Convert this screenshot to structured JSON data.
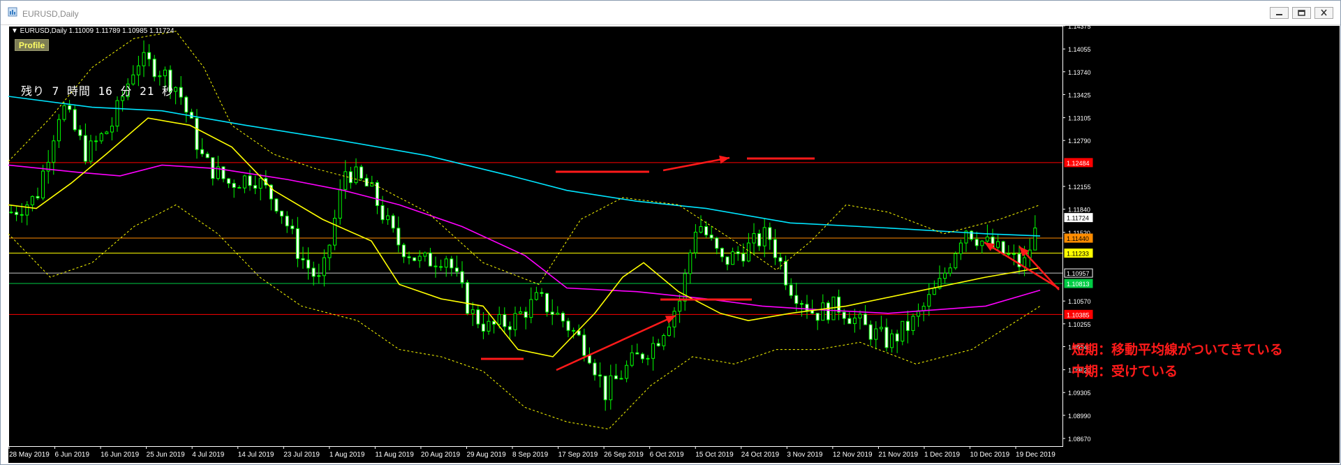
{
  "window": {
    "title": "EURUSD,Daily"
  },
  "chart": {
    "header": "▼ EURUSD,Daily  1.11009 1.11789 1.10985 1.11724",
    "profile_label": "Profile",
    "countdown": "残り 7 時間 16 分 21 秒",
    "annotation_short": "短期：移動平均線がついてきている",
    "annotation_mid": "中期：受けている",
    "price_scale": [
      "1.14375",
      "1.14055",
      "1.13740",
      "1.13425",
      "1.13105",
      "1.12790",
      "1.12155",
      "1.11840",
      "1.11520",
      "1.10570",
      "1.10255",
      "1.09940",
      "1.09620",
      "1.09305",
      "1.08990",
      "1.08670"
    ],
    "price_tags": [
      {
        "value": "1.12484",
        "bg": "#ff0000",
        "fg": "#ffffff"
      },
      {
        "value": "1.11724",
        "bg": "#ffffff",
        "fg": "#000000"
      },
      {
        "value": "1.11440",
        "bg": "#ff8c00",
        "fg": "#000000"
      },
      {
        "value": "1.11233",
        "bg": "#ffff00",
        "fg": "#000000"
      },
      {
        "value": "1.10957",
        "bg": "#000000",
        "fg": "#ffffff"
      },
      {
        "value": "1.10813",
        "bg": "#00cc44",
        "fg": "#ffffff"
      },
      {
        "value": "1.10385",
        "bg": "#ff0000",
        "fg": "#ffffff"
      }
    ],
    "date_labels": [
      "28 May 2019",
      "6 Jun 2019",
      "16 Jun 2019",
      "25 Jun 2019",
      "4 Jul 2019",
      "14 Jul 2019",
      "23 Jul 2019",
      "1 Aug 2019",
      "11 Aug 2019",
      "20 Aug 2019",
      "29 Aug 2019",
      "8 Sep 2019",
      "17 Sep 2019",
      "26 Sep 2019",
      "6 Oct 2019",
      "15 Oct 2019",
      "24 Oct 2019",
      "3 Nov 2019",
      "12 Nov 2019",
      "21 Nov 2019",
      "1 Dec 2019",
      "10 Dec 2019",
      "19 Dec 2019"
    ],
    "colors": {
      "background": "#000000",
      "bull": "#00ff00",
      "bear": "#ffffff",
      "ma_short": "#ffff00",
      "ma_mid": "#ff00ff",
      "ma_long": "#00e5ff",
      "bands": "#ffff00",
      "annotation": "#ff1a1a"
    }
  }
}
